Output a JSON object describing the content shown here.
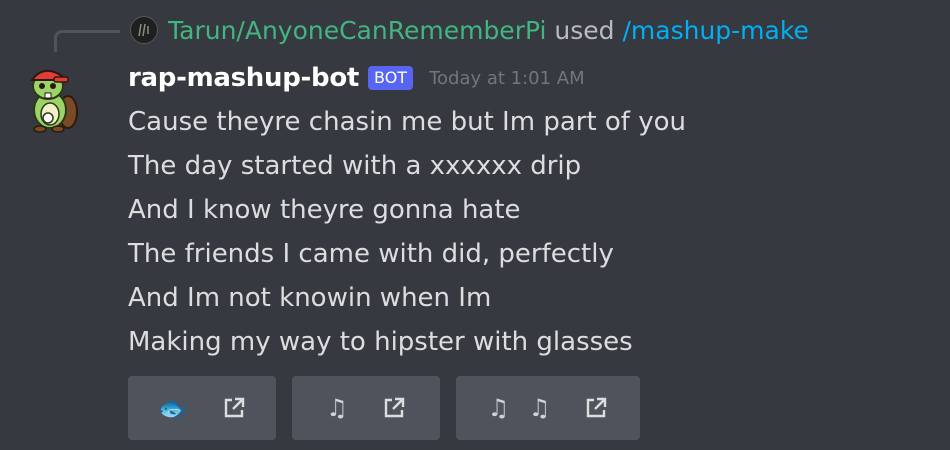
{
  "command": {
    "user": "Tarun/AnyoneCanRememberPi",
    "used_text": "used",
    "command_name": "/mashup-make",
    "user_icon": "band-logo-icon"
  },
  "message": {
    "author": "rap-mashup-bot",
    "badge": "BOT",
    "timestamp": "Today at 1:01 AM",
    "avatar_icon": "beaver-mascot-icon",
    "lines": [
      "Cause theyre chasin me but Im part of you",
      "The day started with a xxxxxx drip",
      "And I know theyre gonna hate",
      "The friends I came with did, perfectly",
      "And Im not knowin when Im",
      "Making my way to hipster with glasses"
    ]
  },
  "buttons": [
    {
      "emoji": "🐟",
      "icon": "external-link-icon"
    },
    {
      "emoji": "♫",
      "icon": "external-link-icon"
    },
    {
      "emoji": "♫ ♫",
      "icon": "external-link-icon"
    }
  ],
  "colors": {
    "background": "#36393f",
    "username_green": "#43b581",
    "command_blue": "#00aff4",
    "bot_badge": "#5865f2",
    "button_bg": "#4f545c"
  }
}
